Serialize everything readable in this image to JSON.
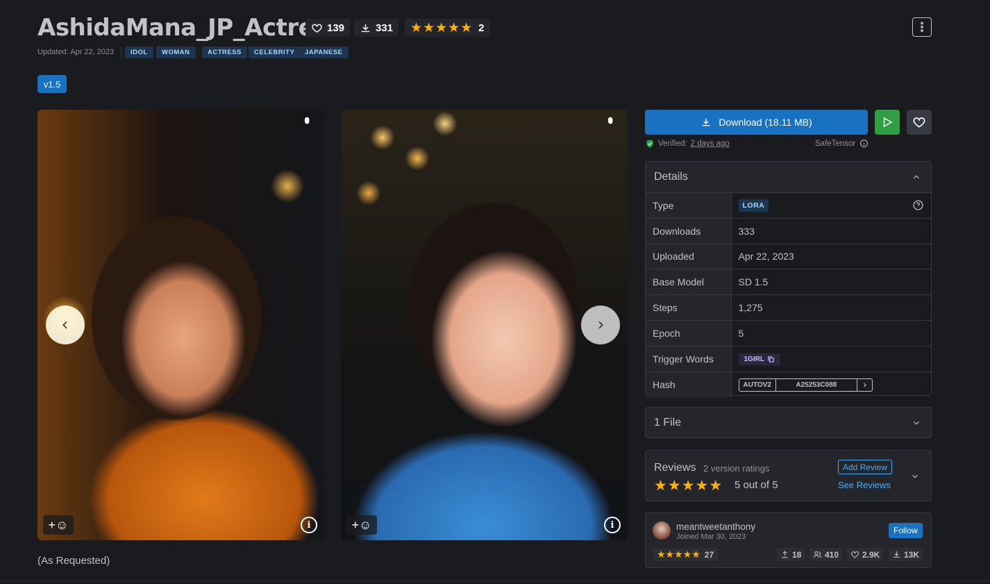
{
  "header": {
    "title": "AshidaMana_JP_Actress",
    "likes": "139",
    "downloads": "331",
    "rating_count": "2",
    "stars": "★★★★★",
    "updated": "Updated: Apr 22, 2023",
    "tags": [
      "IDOL",
      "WOMAN",
      "ACTRESS",
      "CELEBRITY",
      "JAPANESE"
    ],
    "version": "v1.5",
    "menu_icon": "⋮"
  },
  "gallery": {
    "caption": "(As Requested)",
    "prev_icon": "‹",
    "next_icon": "›",
    "react_icon": "+☺",
    "info_icon": "i",
    "kebab": "⋮"
  },
  "sidebar": {
    "download_label": "Download (18.11 MB)",
    "verified_label": "Verified:",
    "verified_time": "2 days ago",
    "safetensor": "SafeTensor",
    "details": {
      "title": "Details",
      "rows": [
        {
          "key": "Type",
          "value": "LORA"
        },
        {
          "key": "Downloads",
          "value": "333"
        },
        {
          "key": "Uploaded",
          "value": "Apr 22, 2023"
        },
        {
          "key": "Base Model",
          "value": "SD 1.5"
        },
        {
          "key": "Steps",
          "value": "1,275"
        },
        {
          "key": "Epoch",
          "value": "5"
        },
        {
          "key": "Trigger Words",
          "value": "1GIRL"
        },
        {
          "key": "Hash",
          "value": "A25253C088",
          "hash_type": "AUTOV2"
        }
      ]
    },
    "files_label": "1 File",
    "reviews": {
      "title": "Reviews",
      "subtitle": "2 version ratings",
      "stars": "★★★★★",
      "score": "5 out of 5",
      "add_label": "Add Review",
      "see_label": "See Reviews"
    },
    "creator": {
      "name": "meantweetanthony",
      "joined": "Joined Mar 30, 2023",
      "follow_label": "Follow",
      "rating_stars": "★★★★★",
      "rating_count": "27",
      "uploads": "18",
      "followers": "410",
      "likes": "2.9K",
      "downloads": "13K"
    }
  },
  "colors": {
    "accent": "#1971c2",
    "play": "#2f9e44",
    "star": "#fab005",
    "background": "#1a1b1e"
  }
}
